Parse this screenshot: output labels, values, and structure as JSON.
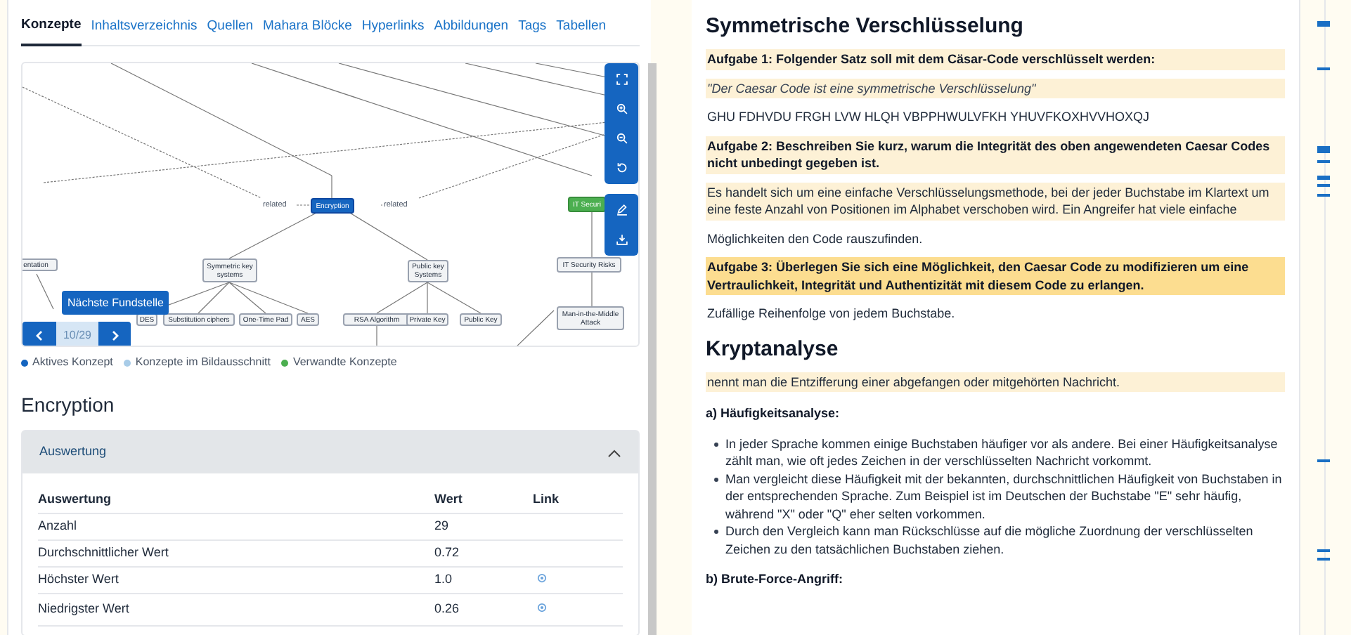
{
  "tabs": [
    {
      "label": "Konzepte",
      "selected": true
    },
    {
      "label": "Inhaltsverzeichnis",
      "selected": false
    },
    {
      "label": "Quellen",
      "selected": false
    },
    {
      "label": "Mahara Blöcke",
      "selected": false
    },
    {
      "label": "Hyperlinks",
      "selected": false
    },
    {
      "label": "Abbildungen",
      "selected": false
    },
    {
      "label": "Tags",
      "selected": false
    },
    {
      "label": "Tabellen",
      "selected": false
    }
  ],
  "concept_map": {
    "nodes": [
      {
        "label": "Encryption",
        "kind": "active"
      },
      {
        "label": "IT Securi",
        "kind": "related"
      },
      {
        "label": "entation",
        "kind": "concept"
      },
      {
        "label": "Symmetric key systems",
        "kind": "concept"
      },
      {
        "label": "Public key Systems",
        "kind": "concept"
      },
      {
        "label": "IT Security Risks",
        "kind": "concept"
      },
      {
        "label": "DES",
        "kind": "concept"
      },
      {
        "label": "Substitution ciphers",
        "kind": "concept"
      },
      {
        "label": "One-Time Pad",
        "kind": "concept"
      },
      {
        "label": "AES",
        "kind": "concept"
      },
      {
        "label": "RSA Algorithm",
        "kind": "concept"
      },
      {
        "label": "Private Key",
        "kind": "concept"
      },
      {
        "label": "Public Key",
        "kind": "concept"
      },
      {
        "label": "Man-in-the-Middle Attack",
        "kind": "concept"
      }
    ],
    "edge_labels": [
      "related",
      "related"
    ],
    "tooltip": "Nächste Fundstelle",
    "counter": "10/29"
  },
  "legend": [
    {
      "label": "Aktives Konzept",
      "color": "#1565c0"
    },
    {
      "label": "Konzepte im Bildausschnitt",
      "color": "#a8cce8"
    },
    {
      "label": "Verwandte Konzepte",
      "color": "#4caf50"
    }
  ],
  "concept_title": "Encryption",
  "accordion": {
    "title": "Auswertung",
    "expanded": true,
    "columns": [
      "Auswertung",
      "Wert",
      "Link"
    ],
    "rows": [
      {
        "cells": [
          "Anzahl",
          "29"
        ],
        "link": false
      },
      {
        "cells": [
          "Durchschnittlicher Wert",
          "0.72"
        ],
        "link": false
      },
      {
        "cells": [
          "Höchster Wert",
          "1.0"
        ],
        "link": true
      },
      {
        "cells": [
          "Niedrigster Wert",
          "0.26"
        ],
        "link": true
      }
    ]
  },
  "document": [
    {
      "kind": "heading",
      "text": "Symmetrische Verschlüsselung"
    },
    {
      "kind": "task",
      "text": "Aufgabe 1: Folgender Satz soll mit dem Cäsar-Code verschlüsselt werden:",
      "color": "#fdf1d6"
    },
    {
      "kind": "quote",
      "text": "\"Der Caesar Code ist eine symmetrische Verschlüsselung\"",
      "color": "#fdf1d6"
    },
    {
      "kind": "paragraph",
      "text": "GHU FDHVDU FRGH LVW HLQH VBPPHWULVFKH YHUVFKOXHVVHOXQJ"
    },
    {
      "kind": "task",
      "text": "Aufgabe 2: Beschreiben Sie kurz, warum die Integrität des oben angewendeten Caesar Codes nicht unbedingt gegeben ist.",
      "color": "#fdf1d6"
    },
    {
      "kind": "paragraph",
      "text": "Es handelt sich um eine einfache Verschlüsselungsmethode, bei der jeder Buchstabe im Klartext um eine feste Anzahl von Positionen im Alphabet verschoben wird. Ein Angreifer hat viele einfache",
      "color": "#fdf1d6"
    },
    {
      "kind": "paragraph",
      "text": "Möglichkeiten den Code rauszufinden."
    },
    {
      "kind": "task",
      "text": "Aufgabe 3: Überlegen Sie sich eine Möglichkeit, den Caesar Code zu modifizieren um eine Vertraulichkeit, Integrität und Authentizität mit diesem Code zu erlangen.",
      "color": "#fcdd90"
    },
    {
      "kind": "paragraph",
      "text": "Zufällige Reihenfolge von jedem Buchstabe."
    },
    {
      "kind": "heading",
      "text": "Kryptanalyse"
    },
    {
      "kind": "paragraph",
      "text": "nennt man die Entzifferung einer abgefangen oder mitgehörten Nachricht.",
      "color": "#fdf1d6"
    },
    {
      "kind": "subheading",
      "text": "a) Häufigkeitsanalyse:"
    },
    {
      "kind": "bullet",
      "text": "In jeder Sprache kommen einige Buchstaben häufiger vor als andere. Bei einer Häufigkeitsanalyse zählt man, wie oft jedes Zeichen in der verschlüsselten Nachricht vorkommt."
    },
    {
      "kind": "bullet",
      "text": "Man vergleicht diese Häufigkeit mit der bekannten, durchschnittlichen Häufigkeit von Buchstaben in der entsprechenden Sprache. Zum Beispiel ist im Deutschen der Buchstabe \"E\" sehr häufig, während \"X\" oder \"Q\" eher selten vorkommen."
    },
    {
      "kind": "bullet",
      "text": "Durch den Vergleich kann man Rückschlüsse auf die mögliche Zuordnung der verschlüsselten Zeichen zu den tatsächlichen Buchstaben ziehen."
    },
    {
      "kind": "subheading",
      "text": "b) Brute-Force-Angriff:"
    }
  ]
}
